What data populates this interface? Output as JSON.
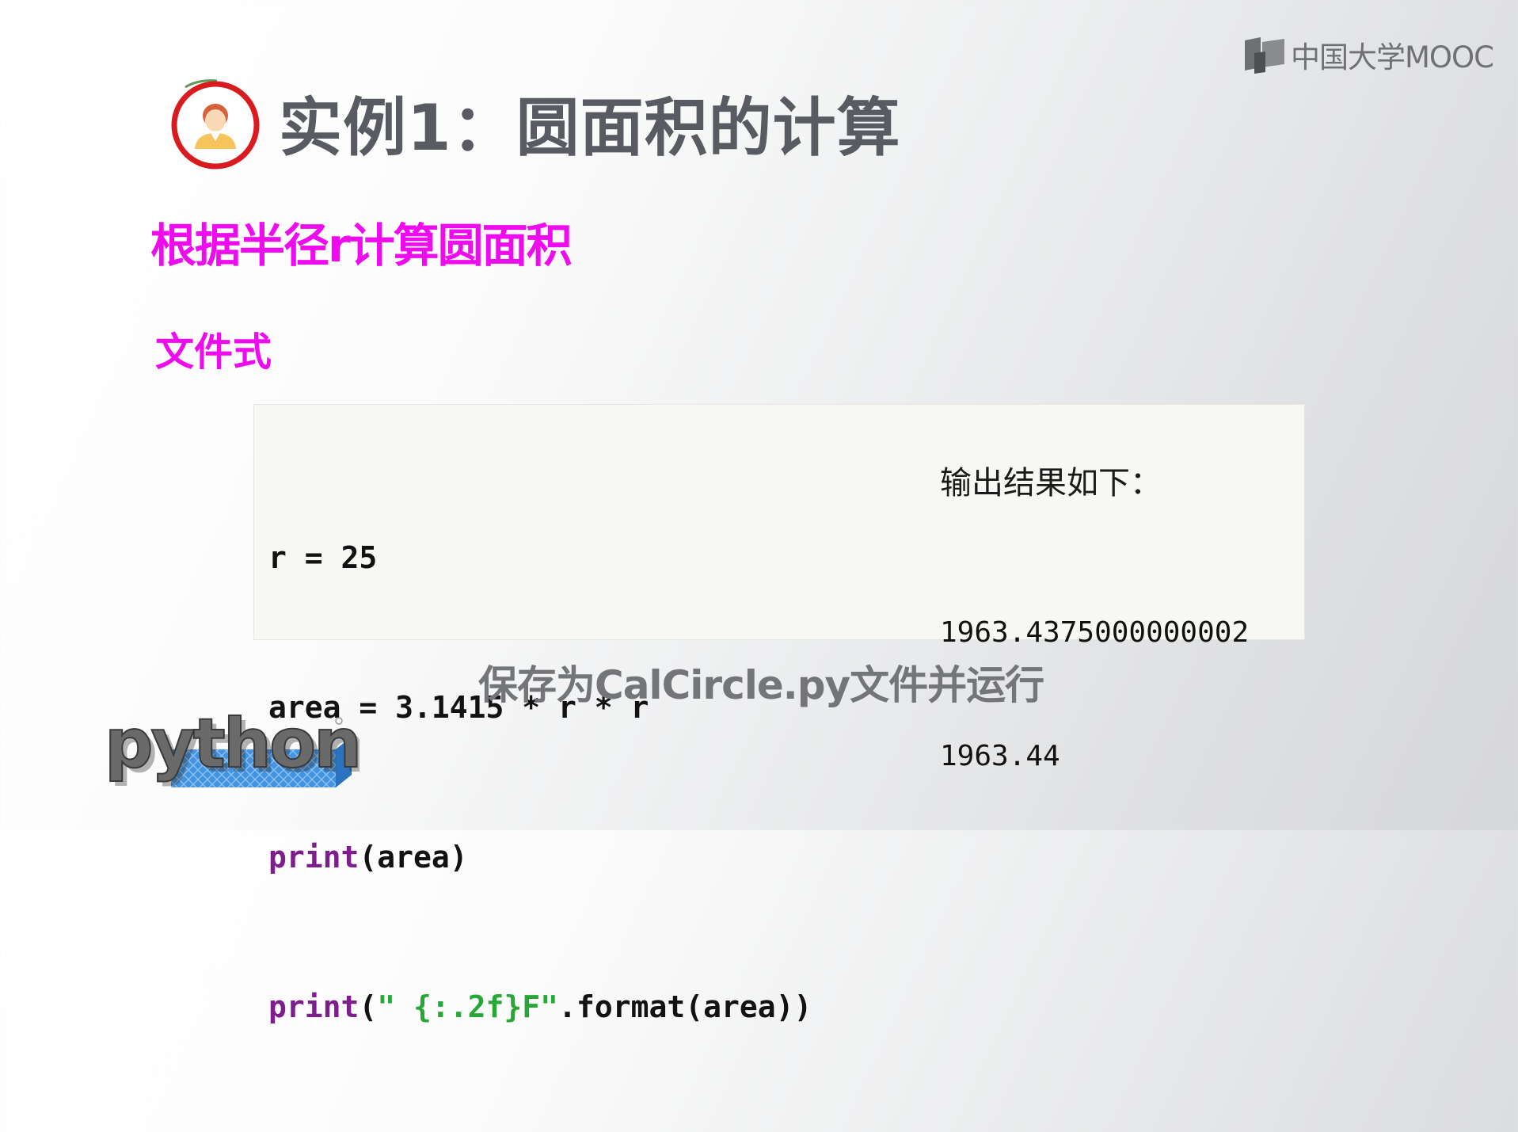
{
  "brand": {
    "logo_text": "中国大学MOOC",
    "logo_icon": "open-book-icon"
  },
  "slide": {
    "title": "实例1：圆面积的计算",
    "title_icon": "teacher-avatar-icon",
    "subtitle": "根据半径r计算圆面积",
    "mode_label": "文件式",
    "code_lines": [
      [
        "",
        "r = 25",
        ""
      ],
      [
        "",
        "area = 3.1415 * r * r",
        ""
      ],
      [
        "print",
        "(area)",
        ""
      ],
      [
        "print",
        "(",
        "\" {:.2f}F\"",
        ".format(area))"
      ]
    ],
    "output_heading": "输出结果如下：",
    "output_lines": [
      "1963.4375000000002",
      "1963.44"
    ],
    "caption": "保存为CalCircle.py文件并运行",
    "python_logo_text": "python"
  },
  "colors": {
    "accent_magenta": "#ee0bee",
    "keyword_purple": "#7c1e8c",
    "string_green": "#27a836",
    "title_gray": "#595b62",
    "avatar_ring_red": "#d91a1f",
    "python_blue": "#3b8fe0"
  }
}
